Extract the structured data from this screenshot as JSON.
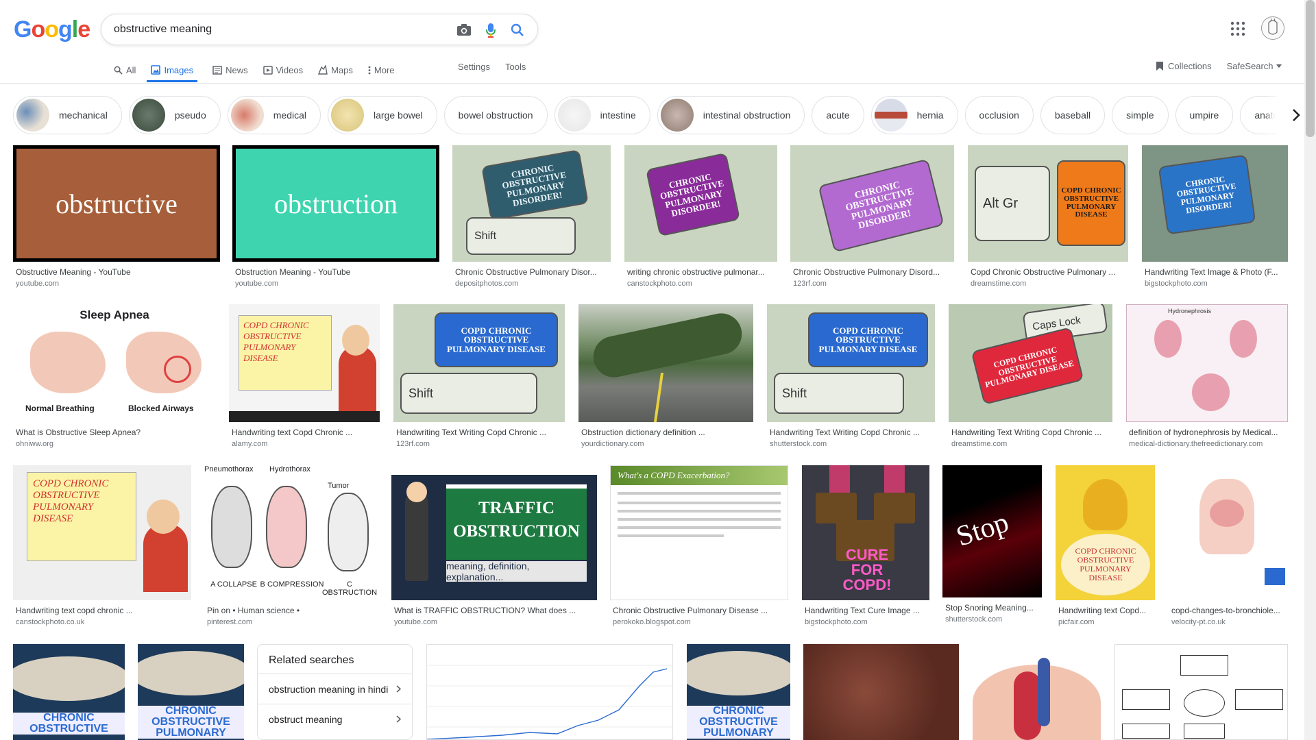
{
  "search": {
    "value": "obstructive meaning",
    "placeholder": ""
  },
  "logo": {
    "g1": "G",
    "o1": "o",
    "o2": "o",
    "g2": "g",
    "l": "l",
    "e": "e"
  },
  "tabs": [
    {
      "label": "All",
      "icon": "search-icon"
    },
    {
      "label": "Images",
      "icon": "image-icon",
      "active": true
    },
    {
      "label": "News",
      "icon": "news-icon"
    },
    {
      "label": "Videos",
      "icon": "video-icon"
    },
    {
      "label": "Maps",
      "icon": "map-icon"
    },
    {
      "label": "More",
      "icon": "more-vert-icon"
    }
  ],
  "tools": {
    "settings": "Settings",
    "tools": "Tools"
  },
  "rightnav": {
    "collections": "Collections",
    "safesearch": "SafeSearch"
  },
  "chips": [
    {
      "label": "mechanical",
      "thumb": true
    },
    {
      "label": "pseudo",
      "thumb": true
    },
    {
      "label": "medical",
      "thumb": true
    },
    {
      "label": "large bowel",
      "thumb": true
    },
    {
      "label": "bowel obstruction",
      "thumb": false
    },
    {
      "label": "intestine",
      "thumb": true
    },
    {
      "label": "intestinal obstruction",
      "thumb": true
    },
    {
      "label": "acute",
      "thumb": false
    },
    {
      "label": "hernia",
      "thumb": true
    },
    {
      "label": "occlusion",
      "thumb": false
    },
    {
      "label": "baseball",
      "thumb": false
    },
    {
      "label": "simple",
      "thumb": false
    },
    {
      "label": "umpire",
      "thumb": false
    },
    {
      "label": "anatomy p",
      "thumb": false
    }
  ],
  "results": {
    "r1": {
      "cap": "Obstructive Meaning - YouTube",
      "src": "youtube.com",
      "word": "obstructive"
    },
    "r2": {
      "cap": "Obstruction Meaning - YouTube",
      "src": "youtube.com",
      "word": "obstruction"
    },
    "r3": {
      "cap": "Chronic Obstructive Pulmonary Disor...",
      "src": "depositphotos.com",
      "key": "CHRONIC OBSTRUCTIVE PULMONARY DISORDER!",
      "shift": "Shift"
    },
    "r4": {
      "cap": "writing chronic obstructive pulmonar...",
      "src": "canstockphoto.com",
      "key": "CHRONIC OBSTRUCTIVE PULMONARY DISORDER!"
    },
    "r5": {
      "cap": "Chronic Obstructive Pulmonary Disord...",
      "src": "123rf.com",
      "key": "CHRONIC OBSTRUCTIVE PULMONARY DISORDER!"
    },
    "r6": {
      "cap": "Copd Chronic Obstructive Pulmonary ...",
      "src": "dreamstime.com",
      "key": "COPD CHRONIC OBSTRUCTIVE PULMONARY DISEASE",
      "altgr": "Alt Gr"
    },
    "r7": {
      "cap": "Handwriting Text Image & Photo (F...",
      "src": "bigstockphoto.com",
      "key": "CHRONIC OBSTRUCTIVE PULMONARY DISORDER!"
    },
    "r8": {
      "cap": "What is Obstructive Sleep Apnea?",
      "src": "ohniww.org",
      "title": "Sleep Apnea",
      "left": "Normal Breathing",
      "right": "Blocked Airways"
    },
    "r9": {
      "cap": "Handwriting text Copd Chronic ...",
      "src": "alamy.com",
      "note": "COPD CHRONIC OBSTRUCTIVE PULMONARY DISEASE"
    },
    "r10": {
      "cap": "Handwriting Text Writing Copd Chronic ...",
      "src": "123rf.com",
      "key": "COPD CHRONIC OBSTRUCTIVE PULMONARY DISEASE",
      "shift": "Shift"
    },
    "r11": {
      "cap": "Obstruction dictionary definition ...",
      "src": "yourdictionary.com"
    },
    "r12": {
      "cap": "Handwriting Text Writing Copd Chronic ...",
      "src": "shutterstock.com",
      "key": "COPD CHRONIC OBSTRUCTIVE PULMONARY DISEASE",
      "shift": "Shift"
    },
    "r13": {
      "cap": "Handwriting Text Writing Copd Chronic ...",
      "src": "dreamstime.com",
      "key": "COPD CHRONIC OBSTRUCTIVE PULMONARY DISEASE",
      "caps": "Caps Lock"
    },
    "r14": {
      "cap": "definition of hydronephrosis by Medical...",
      "src": "medical-dictionary.thefreedictionary.com",
      "label": "Hydronephrosis"
    },
    "r15": {
      "cap": "Handwriting text copd chronic ...",
      "src": "canstockphoto.co.uk",
      "note": "COPD CHRONIC OBSTRUCTIVE PULMONARY DISEASE"
    },
    "r16": {
      "cap": "Pin on • Human science •",
      "src": "pinterest.com",
      "a": "A COLLAPSE",
      "b": "B COMPRESSION",
      "c": "C OBSTRUCTION",
      "t1": "Pneumothorax",
      "t2": "Hydrothorax",
      "t3": "Tumor"
    },
    "r17": {
      "cap": "What is TRAFFIC OBSTRUCTION? What does ...",
      "src": "youtube.com",
      "t1": "TRAFFIC",
      "t2": "OBSTRUCTION",
      "sub": "meaning, definition, explanation..."
    },
    "r18": {
      "cap": "Chronic Obstructive Pulmonary Disease ...",
      "src": "perokoko.blogspot.com",
      "title": "What's a COPD Exacerbation?"
    },
    "r19": {
      "cap": "Handwriting Text Cure Image ...",
      "src": "bigstockphoto.com",
      "text": "CURE FOR COPD!"
    },
    "r20": {
      "cap": "Stop Snoring Meaning...",
      "src": "shutterstock.com",
      "text": "Stop"
    },
    "r21": {
      "cap": "Handwriting text Copd...",
      "src": "picfair.com",
      "text": "COPD CHRONIC OBSTRUCTIVE PULMONARY DISEASE"
    },
    "r22": {
      "cap": "copd-changes-to-bronchiole...",
      "src": "velocity-pt.co.uk"
    },
    "r23": {
      "text": "CHRONIC OBSTRUCTIVE"
    },
    "r24": {
      "text": "CHRONIC OBSTRUCTIVE PULMONARY"
    },
    "r27": {
      "text": "CHRONIC OBSTRUCTIVE PULMONARY"
    }
  },
  "related": {
    "title": "Related searches",
    "items": [
      "obstruction meaning in hindi",
      "obstruct meaning"
    ]
  },
  "colors": {
    "accent": "#1a73e8",
    "border": "#dfe1e5"
  }
}
